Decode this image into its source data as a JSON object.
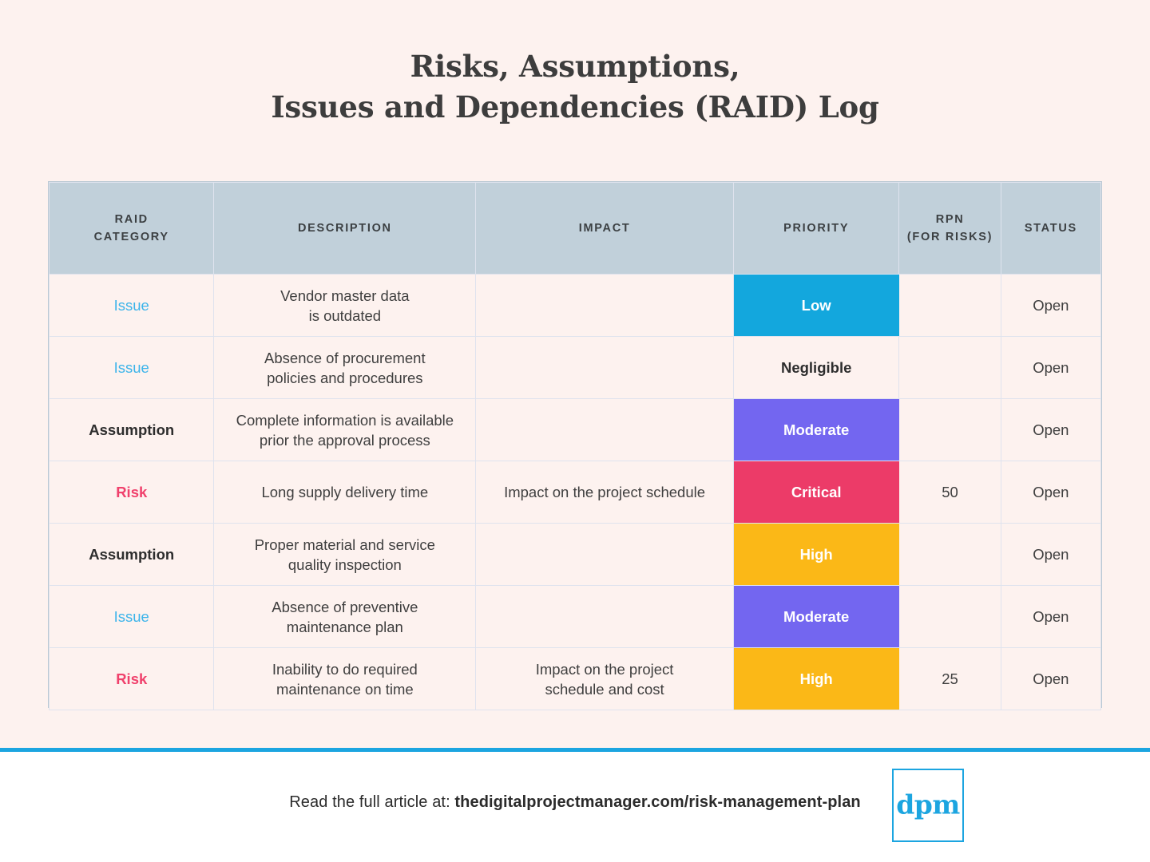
{
  "page": {
    "background_color": "#fdf2ef",
    "footer_background_color": "#ffffff",
    "divider_color": "#1ca5e0"
  },
  "title": {
    "line1": "Risks, Assumptions,",
    "line2": "Issues and Dependencies (RAID) Log"
  },
  "table": {
    "header_background": "#c1d0da",
    "columns": [
      {
        "key": "category",
        "label": "RAID",
        "label2": "CATEGORY"
      },
      {
        "key": "description",
        "label": "DESCRIPTION",
        "label2": ""
      },
      {
        "key": "impact",
        "label": "IMPACT",
        "label2": ""
      },
      {
        "key": "priority",
        "label": "PRIORITY",
        "label2": ""
      },
      {
        "key": "rpn",
        "label": "RPN",
        "label2": "(FOR RISKS)"
      },
      {
        "key": "status",
        "label": "STATUS",
        "label2": ""
      }
    ],
    "category_colors": {
      "Issue": "#3cb4ea",
      "Risk": "#f0416c",
      "Assumption": "#2d2d2d",
      "Dependency": "#7b6cf6"
    },
    "priority_colors": {
      "Low": "#13a7dd",
      "Negligible": "",
      "Moderate": "#7366f0",
      "Critical": "#ec3b68",
      "High": "#fbb817"
    },
    "rows": [
      {
        "category": "Issue",
        "description_line1": "Vendor master data",
        "description_line2": "is outdated",
        "impact_line1": "",
        "impact_line2": "",
        "priority": "Low",
        "rpn": "",
        "status": "Open"
      },
      {
        "category": "Issue",
        "description_line1": "Absence of procurement",
        "description_line2": "policies and procedures",
        "impact_line1": "",
        "impact_line2": "",
        "priority": "Negligible",
        "rpn": "",
        "status": "Open"
      },
      {
        "category": "Assumption",
        "description_line1": "Complete information is available",
        "description_line2": "prior the approval process",
        "impact_line1": "",
        "impact_line2": "",
        "priority": "Moderate",
        "rpn": "",
        "status": "Open"
      },
      {
        "category": "Risk",
        "description_line1": "Long supply delivery time",
        "description_line2": "",
        "impact_line1": "Impact on the project schedule",
        "impact_line2": "",
        "priority": "Critical",
        "rpn": "50",
        "status": "Open"
      },
      {
        "category": "Assumption",
        "description_line1": "Proper material and service",
        "description_line2": "quality inspection",
        "impact_line1": "",
        "impact_line2": "",
        "priority": "High",
        "rpn": "",
        "status": "Open"
      },
      {
        "category": "Issue",
        "description_line1": "Absence of preventive",
        "description_line2": "maintenance plan",
        "impact_line1": "",
        "impact_line2": "",
        "priority": "Moderate",
        "rpn": "",
        "status": "Open"
      },
      {
        "category": "Risk",
        "description_line1": "Inability to do required",
        "description_line2": "maintenance on time",
        "impact_line1": "Impact on the project",
        "impact_line2": "schedule and cost",
        "priority": "High",
        "rpn": "25",
        "status": "Open"
      }
    ]
  },
  "footer": {
    "lead": "Read the full article at: ",
    "url": "thedigitalprojectmanager.com/risk-management-plan",
    "logo_text": "dpm",
    "logo_color": "#1ca5e0"
  }
}
